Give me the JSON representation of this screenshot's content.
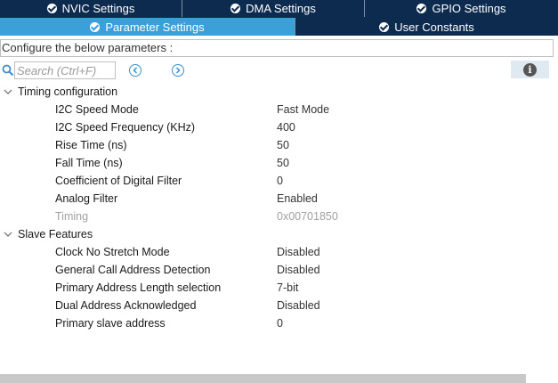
{
  "tabs_top": [
    {
      "label": "NVIC Settings"
    },
    {
      "label": "DMA Settings"
    },
    {
      "label": "GPIO Settings"
    }
  ],
  "tabs_second": [
    {
      "label": "Parameter Settings",
      "active": true
    },
    {
      "label": "User Constants",
      "active": false
    }
  ],
  "configure_text": "Configure the below parameters :",
  "search": {
    "placeholder": "Search (Ctrl+F)"
  },
  "groups": [
    {
      "label": "Timing configuration",
      "params": [
        {
          "label": "I2C Speed Mode",
          "value": "Fast Mode"
        },
        {
          "label": "I2C Speed Frequency (KHz)",
          "value": "400"
        },
        {
          "label": "Rise Time (ns)",
          "value": "50"
        },
        {
          "label": "Fall Time (ns)",
          "value": "50"
        },
        {
          "label": "Coefficient of Digital Filter",
          "value": "0"
        },
        {
          "label": "Analog Filter",
          "value": "Enabled"
        },
        {
          "label": "Timing",
          "value": "0x00701850",
          "disabled": true
        }
      ]
    },
    {
      "label": "Slave Features",
      "params": [
        {
          "label": "Clock No Stretch Mode",
          "value": "Disabled"
        },
        {
          "label": "General Call Address Detection",
          "value": "Disabled"
        },
        {
          "label": "Primary Address Length selection",
          "value": "7-bit"
        },
        {
          "label": "Dual Address Acknowledged",
          "value": "Disabled"
        },
        {
          "label": "Primary slave address",
          "value": "0"
        }
      ]
    }
  ],
  "colors": {
    "tab_bar": "#0d2a4f",
    "tab_active": "#3aa0d8",
    "accent": "#3a8fd0",
    "disabled_text": "#a0a0a0"
  },
  "icons": {
    "tab_status": "check-circle-icon",
    "search": "search-icon",
    "prev": "chevron-left-circle-icon",
    "next": "chevron-right-circle-icon",
    "info": "info-icon",
    "group_toggle": "chevron-down-icon"
  }
}
